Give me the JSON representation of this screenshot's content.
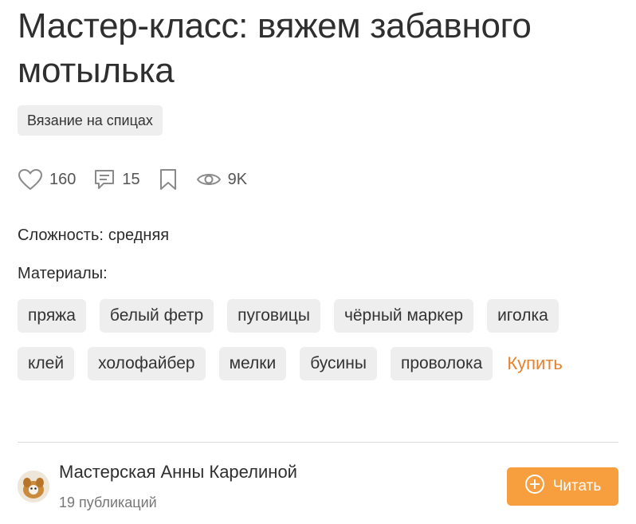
{
  "article": {
    "title": "Мастер-класс: вяжем забавного мотылька",
    "category": "Вязание на спицах"
  },
  "stats": {
    "likes": "160",
    "comments": "15",
    "views": "9K",
    "icons": [
      "heart-icon",
      "comment-icon",
      "bookmark-icon",
      "eye-icon"
    ]
  },
  "difficulty": {
    "label": "Сложность:",
    "value": "средняя"
  },
  "materials": {
    "label": "Материалы:",
    "items": [
      "пряжа",
      "белый фетр",
      "пуговицы",
      "чёрный маркер",
      "иголка",
      "клей",
      "холофайбер",
      "мелки",
      "бусины",
      "проволока"
    ],
    "buy_link": "Купить"
  },
  "author": {
    "name": "Мастерская Анны Карелиной",
    "publications": "19 публикаций",
    "read_button": "Читать"
  },
  "colors": {
    "accent": "#f79e3e",
    "link": "#e8812c",
    "chip_bg": "#eeeeee",
    "text": "#2b2b2b"
  }
}
